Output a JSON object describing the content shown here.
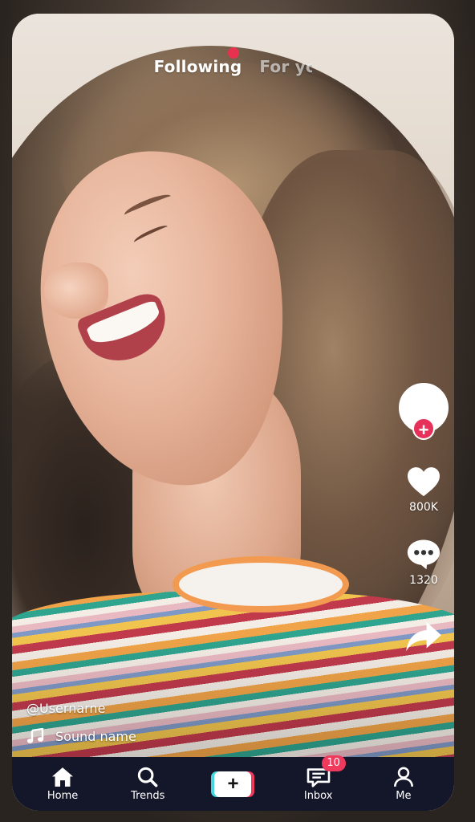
{
  "top_tabs": {
    "following": "Following",
    "for_you": "For you"
  },
  "rail": {
    "likes_count": "800K",
    "comments_count": "1320",
    "follow_symbol": "+"
  },
  "caption": {
    "username": "@Usernarne",
    "sound_name": "Sound name"
  },
  "bottom_nav": {
    "home": "Home",
    "trends": "Trends",
    "create_symbol": "+",
    "inbox": "Inbox",
    "inbox_badge": "10",
    "me": "Me"
  },
  "colors": {
    "accent": "#ef3a5d",
    "nav_background": "#14172a",
    "create_cyan": "#47d6e0"
  },
  "icons": [
    "heart-icon",
    "comment-icon",
    "share-icon",
    "music-note-icon",
    "home-icon",
    "search-icon",
    "inbox-icon",
    "profile-icon"
  ]
}
